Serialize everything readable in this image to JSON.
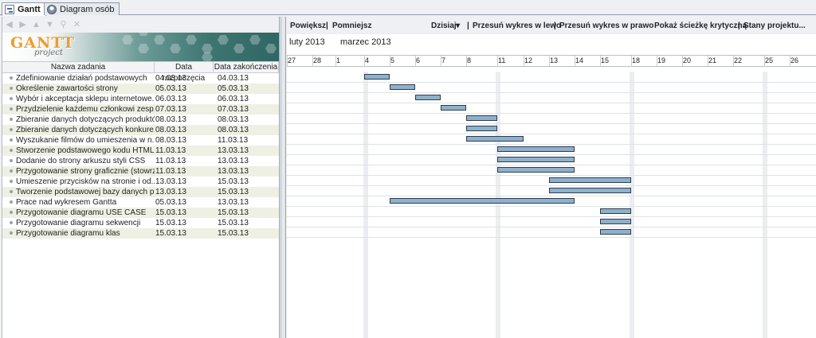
{
  "tabs": [
    {
      "label": "Gantt",
      "active": true,
      "icon": "gantt-chart-icon"
    },
    {
      "label": "Diagram osób",
      "active": false,
      "icon": "person-icon"
    }
  ],
  "left_toolbar": {
    "icons": [
      "arrow-left-icon",
      "arrow-right-icon",
      "arrow-up-icon",
      "arrow-down-icon",
      "link-icon",
      "unlink-icon"
    ]
  },
  "logo": {
    "main": "GANTT",
    "sub": "project",
    "accent": "#f19b2c"
  },
  "table": {
    "headers": [
      "Nazwa zadania",
      "Data rozpoczęcia",
      "Data zakończenia"
    ],
    "rows": [
      {
        "name": "Zdefiniowanie działań podstawowych",
        "start": "04.03.13",
        "end": "04.03.13"
      },
      {
        "name": "Określenie zawartości strony",
        "start": "05.03.13",
        "end": "05.03.13"
      },
      {
        "name": "Wybór i akceptacja sklepu internetowe...",
        "start": "06.03.13",
        "end": "06.03.13"
      },
      {
        "name": "Przydzielenie każdemu członkowi zesp...",
        "start": "07.03.13",
        "end": "07.03.13"
      },
      {
        "name": "Zbieranie danych dotyczących produktów",
        "start": "08.03.13",
        "end": "08.03.13"
      },
      {
        "name": "Zbieranie danych dotyczących konkure...",
        "start": "08.03.13",
        "end": "08.03.13"
      },
      {
        "name": "Wyszukanie filmów do umieszenia w n...",
        "start": "08.03.13",
        "end": "11.03.13"
      },
      {
        "name": "Stworzenie podstawowego kodu HTML...",
        "start": "11.03.13",
        "end": "13.03.13"
      },
      {
        "name": "Dodanie do strony arkuszu styli CSS",
        "start": "11.03.13",
        "end": "13.03.13"
      },
      {
        "name": "Przygotowanie strony graficznie (stowrz...",
        "start": "11.03.13",
        "end": "13.03.13"
      },
      {
        "name": "Umieszenie przycisków na stronie i od...",
        "start": "13.03.13",
        "end": "15.03.13"
      },
      {
        "name": "Tworzenie podstawowej bazy danych p...",
        "start": "13.03.13",
        "end": "15.03.13"
      },
      {
        "name": "Prace nad wykresem Gantta",
        "start": "05.03.13",
        "end": "13.03.13"
      },
      {
        "name": "Przygotowanie diagramu USE CASE",
        "start": "15.03.13",
        "end": "15.03.13"
      },
      {
        "name": "Przygotowanie diagramu sekwencji",
        "start": "15.03.13",
        "end": "15.03.13"
      },
      {
        "name": "Przygotowanie diagramu klas",
        "start": "15.03.13",
        "end": "15.03.13"
      }
    ]
  },
  "right_toolbar": {
    "zoom_in": "Powiększ",
    "zoom_out": "Pomniejsz",
    "today": "Dzisiaj",
    "scroll_left": "Przesuń wykres w lewo",
    "scroll_right": "Przesuń wykres w prawo",
    "critical_path": "Pokaż ścieżkę krytyczną",
    "baselines": "Stany projektu...",
    "separator": "|"
  },
  "timeline": {
    "months": [
      "luty 2013",
      "marzec 2013"
    ],
    "days": [
      "27",
      "28",
      "1",
      "4",
      "5",
      "6",
      "7",
      "8",
      "11",
      "12",
      "13",
      "14",
      "15",
      "18",
      "19",
      "20",
      "21",
      "22",
      "25",
      "26"
    ]
  },
  "gantt": {
    "bar_color": "#8fb0cc",
    "bars": [
      {
        "start": "4",
        "end": "4"
      },
      {
        "start": "5",
        "end": "5"
      },
      {
        "start": "6",
        "end": "6"
      },
      {
        "start": "7",
        "end": "7"
      },
      {
        "start": "8",
        "end": "8"
      },
      {
        "start": "8",
        "end": "8"
      },
      {
        "start": "8",
        "end": "11"
      },
      {
        "start": "11",
        "end": "13"
      },
      {
        "start": "11",
        "end": "13"
      },
      {
        "start": "11",
        "end": "13"
      },
      {
        "start": "13",
        "end": "15"
      },
      {
        "start": "13",
        "end": "15"
      },
      {
        "start": "5",
        "end": "13"
      },
      {
        "start": "15",
        "end": "15"
      },
      {
        "start": "15",
        "end": "15"
      },
      {
        "start": "15",
        "end": "15"
      }
    ]
  }
}
